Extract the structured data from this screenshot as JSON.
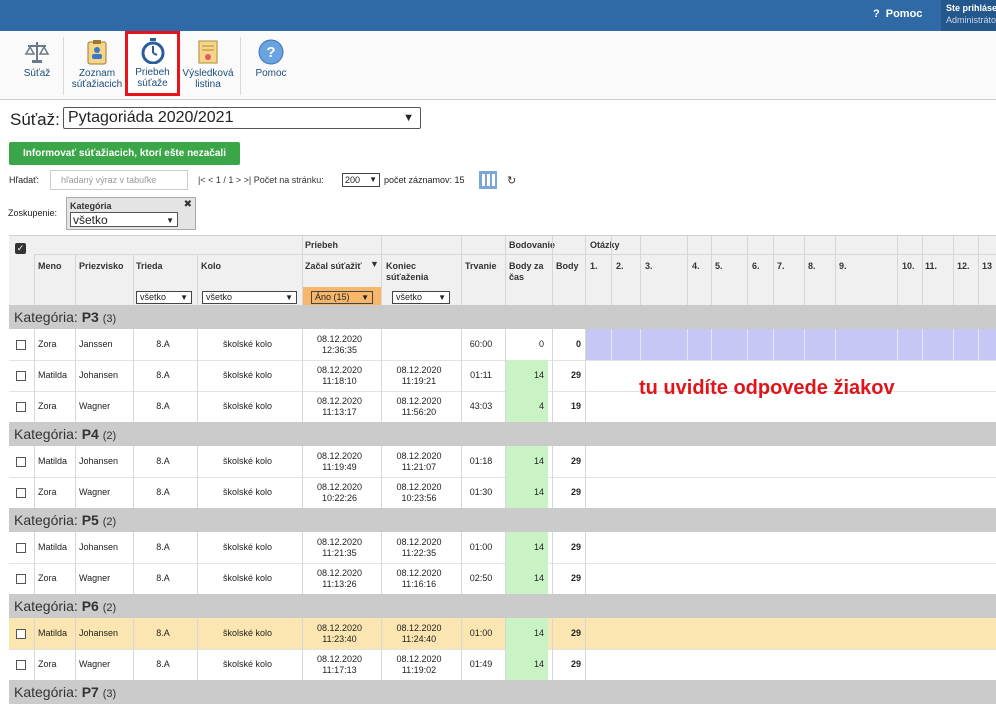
{
  "topbar": {
    "help": "Pomoc",
    "user_line1": "Ste prihlásení",
    "user_line2": "Administrátor"
  },
  "toolbar": {
    "items": [
      {
        "label": "Súťaž",
        "icon": "scales-icon"
      },
      {
        "label": "Zoznam súťažiacich",
        "icon": "contestants-list-icon"
      },
      {
        "label": "Priebeh súťaže",
        "icon": "stopwatch-icon"
      },
      {
        "label": "Výsledková listina",
        "icon": "results-list-icon"
      },
      {
        "label": "Pomoc",
        "icon": "help-icon"
      }
    ]
  },
  "competition": {
    "label": "Súťaž:",
    "value": "Pytagoriáda 2020/2021"
  },
  "notify_button": "Informovať súťažiacich, ktorí ešte nezačali súťažiť",
  "search": {
    "label": "Hľadať:",
    "placeholder": "hľadaný výraz v tabuľke"
  },
  "pager": {
    "text": "|< < 1 / 1 > >|  Počet na stránku:",
    "per_page": "200",
    "count_label": "počet záznamov: 15"
  },
  "grouping": {
    "label": "Zoskupenie:",
    "box_title": "Kategória",
    "value": "všetko"
  },
  "table": {
    "group_headers": {
      "priebeh": "Priebeh",
      "bodovanie": "Bodovanie",
      "otazky": "Otázky"
    },
    "columns": {
      "meno": "Meno",
      "priezvisko": "Priezvisko",
      "trieda": "Trieda",
      "kolo": "Kolo",
      "zacal": "Začal súťažiť",
      "koniec": "Koniec súťaženia",
      "trvanie": "Trvanie",
      "body_za_cas": "Body za čas",
      "body": "Body"
    },
    "question_numbers": [
      "1.",
      "2.",
      "3.",
      "4.",
      "5.",
      "6.",
      "7.",
      "8.",
      "9.",
      "10.",
      "11.",
      "12.",
      "13"
    ],
    "filters": {
      "trieda": "všetko",
      "kolo": "všetko",
      "zacal": "Áno (15)",
      "koniec": "všetko"
    },
    "category_prefix": "Kategória:",
    "categories": [
      {
        "name": "P3",
        "count": "(3)",
        "rows": [
          {
            "meno": "Zora",
            "priezvisko": "Janssen",
            "trieda": "8.A",
            "kolo": "školské kolo",
            "zacal": "08.12.2020\n12:36:35",
            "koniec": "",
            "trvanie": "60:00",
            "body_za_cas": "0",
            "body": "0"
          },
          {
            "meno": "Matilda",
            "priezvisko": "Johansen",
            "trieda": "8.A",
            "kolo": "školské kolo",
            "zacal": "08.12.2020\n11:18:10",
            "koniec": "08.12.2020\n11:19:21",
            "trvanie": "01:11",
            "body_za_cas": "14",
            "body": "29"
          },
          {
            "meno": "Zora",
            "priezvisko": "Wagner",
            "trieda": "8.A",
            "kolo": "školské kolo",
            "zacal": "08.12.2020\n11:13:17",
            "koniec": "08.12.2020\n11:56:20",
            "trvanie": "43:03",
            "body_za_cas": "4",
            "body": "19"
          }
        ]
      },
      {
        "name": "P4",
        "count": "(2)",
        "rows": [
          {
            "meno": "Matilda",
            "priezvisko": "Johansen",
            "trieda": "8.A",
            "kolo": "školské kolo",
            "zacal": "08.12.2020\n11:19:49",
            "koniec": "08.12.2020\n11:21:07",
            "trvanie": "01:18",
            "body_za_cas": "14",
            "body": "29"
          },
          {
            "meno": "Zora",
            "priezvisko": "Wagner",
            "trieda": "8.A",
            "kolo": "školské kolo",
            "zacal": "08.12.2020\n10:22:26",
            "koniec": "08.12.2020\n10:23:56",
            "trvanie": "01:30",
            "body_za_cas": "14",
            "body": "29"
          }
        ]
      },
      {
        "name": "P5",
        "count": "(2)",
        "rows": [
          {
            "meno": "Matilda",
            "priezvisko": "Johansen",
            "trieda": "8.A",
            "kolo": "školské kolo",
            "zacal": "08.12.2020\n11:21:35",
            "koniec": "08.12.2020\n11:22:35",
            "trvanie": "01:00",
            "body_za_cas": "14",
            "body": "29"
          },
          {
            "meno": "Zora",
            "priezvisko": "Wagner",
            "trieda": "8.A",
            "kolo": "školské kolo",
            "zacal": "08.12.2020\n11:13:26",
            "koniec": "08.12.2020\n11:16:16",
            "trvanie": "02:50",
            "body_za_cas": "14",
            "body": "29"
          }
        ]
      },
      {
        "name": "P6",
        "count": "(2)",
        "rows": [
          {
            "meno": "Matilda",
            "priezvisko": "Johansen",
            "trieda": "8.A",
            "kolo": "školské kolo",
            "zacal": "08.12.2020\n11:23:40",
            "koniec": "08.12.2020\n11:24:40",
            "trvanie": "01:00",
            "body_za_cas": "14",
            "body": "29",
            "highlight": true
          },
          {
            "meno": "Zora",
            "priezvisko": "Wagner",
            "trieda": "8.A",
            "kolo": "školské kolo",
            "zacal": "08.12.2020\n11:17:13",
            "koniec": "08.12.2020\n11:19:02",
            "trvanie": "01:49",
            "body_za_cas": "14",
            "body": "29"
          }
        ]
      },
      {
        "name": "P7",
        "count": "(3)",
        "rows": []
      }
    ]
  },
  "annotation": "tu uvidíte odpovede žiakov",
  "colors": {
    "topbar": "#2f6aa6",
    "notify": "#3aa648",
    "highlight_row": "#fbe6b1",
    "score_green": "#c9f3c4",
    "answers": "#c7c7f5",
    "annotation": "#e0141b"
  }
}
